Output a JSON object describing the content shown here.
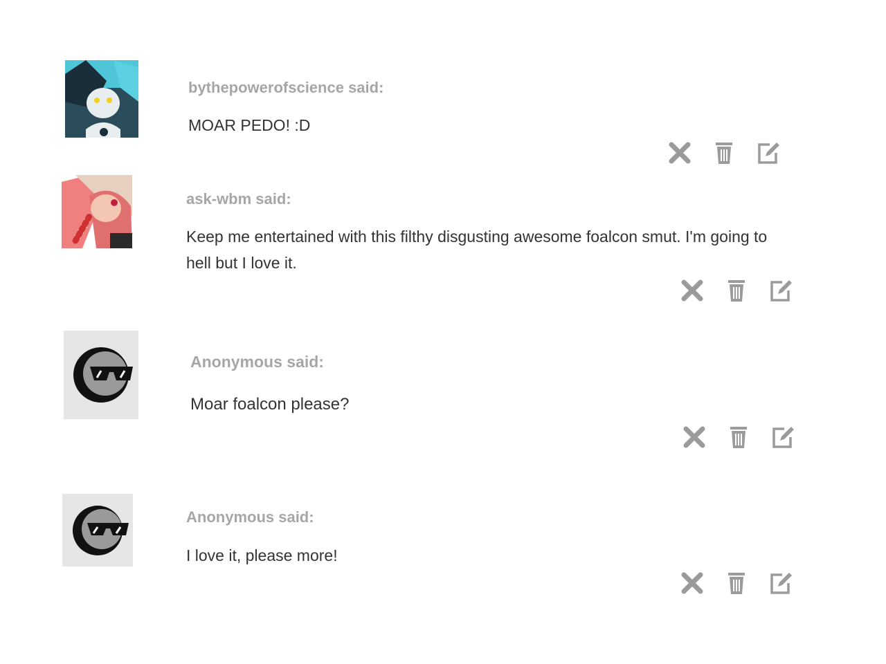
{
  "messages": [
    {
      "asker": "bythepowerofscience said:",
      "question": "MOAR PEDO! :D",
      "avatar_icon": "pony-portrait-avatar"
    },
    {
      "asker": "ask-wbm said:",
      "question": "Keep me entertained with this filthy disgusting awesome foalcon smut. I'm going to hell but I love it.",
      "avatar_icon": "pony-candy-cane-avatar"
    },
    {
      "asker": "Anonymous said:",
      "question": "Moar foalcon please?",
      "avatar_icon": "anonymous-sunglasses-avatar"
    },
    {
      "asker": "Anonymous said:",
      "question": "I love it, please more!",
      "avatar_icon": "anonymous-sunglasses-avatar"
    }
  ],
  "actions": [
    "close-icon",
    "trash-icon",
    "edit-icon"
  ],
  "colors": {
    "asker_text": "#a6a6a6",
    "question_text": "#333333",
    "action_icon": "#9b9b9b"
  }
}
